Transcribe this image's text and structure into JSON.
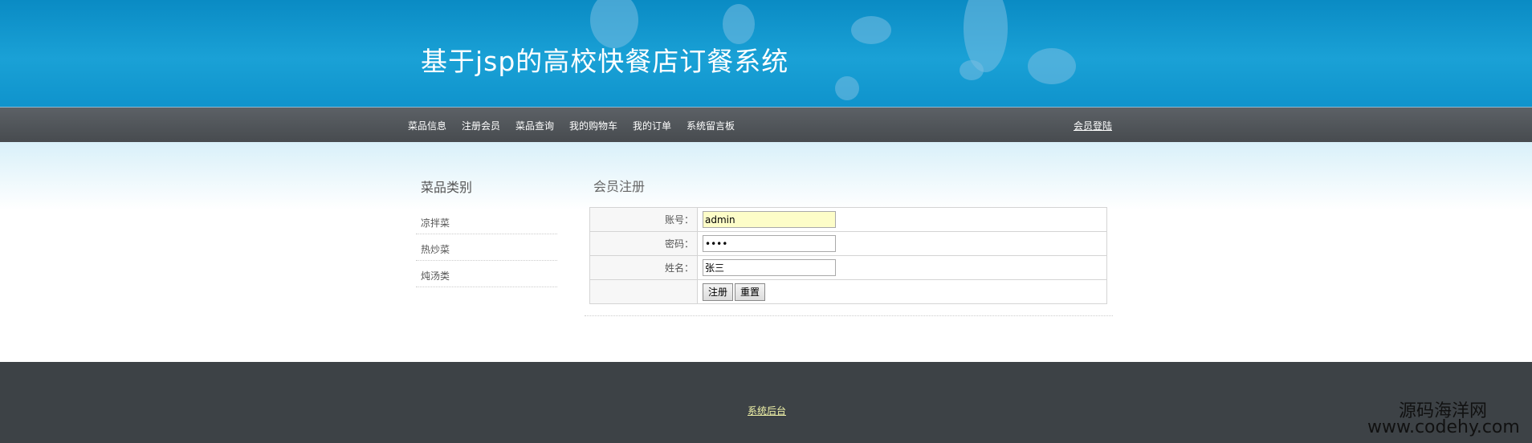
{
  "header": {
    "title": "基于jsp的高校快餐店订餐系统"
  },
  "nav": {
    "items": [
      {
        "label": "菜品信息"
      },
      {
        "label": "注册会员"
      },
      {
        "label": "菜品查询"
      },
      {
        "label": "我的购物车"
      },
      {
        "label": "我的订单"
      },
      {
        "label": "系统留言板"
      }
    ],
    "login": "会员登陆"
  },
  "sidebar": {
    "title": "菜品类别",
    "items": [
      {
        "label": "凉拌菜"
      },
      {
        "label": "热炒菜"
      },
      {
        "label": "炖汤类"
      }
    ]
  },
  "main": {
    "title": "会员注册",
    "form": {
      "account_label": "账号：",
      "account_value": "admin",
      "password_label": "密码：",
      "password_value": "1234",
      "name_label": "姓名：",
      "name_value": "张三",
      "submit_label": "注册",
      "reset_label": "重置"
    }
  },
  "footer": {
    "link": "系统后台"
  },
  "watermark": {
    "line1": "源码海洋网",
    "line2": "www.codehy.com"
  },
  "colors": {
    "header": "#1aa1d6",
    "nav": "#474b4f",
    "footer": "#3d4246",
    "footer_link": "#f0f2a8",
    "input_highlight": "#fdfdc8"
  }
}
